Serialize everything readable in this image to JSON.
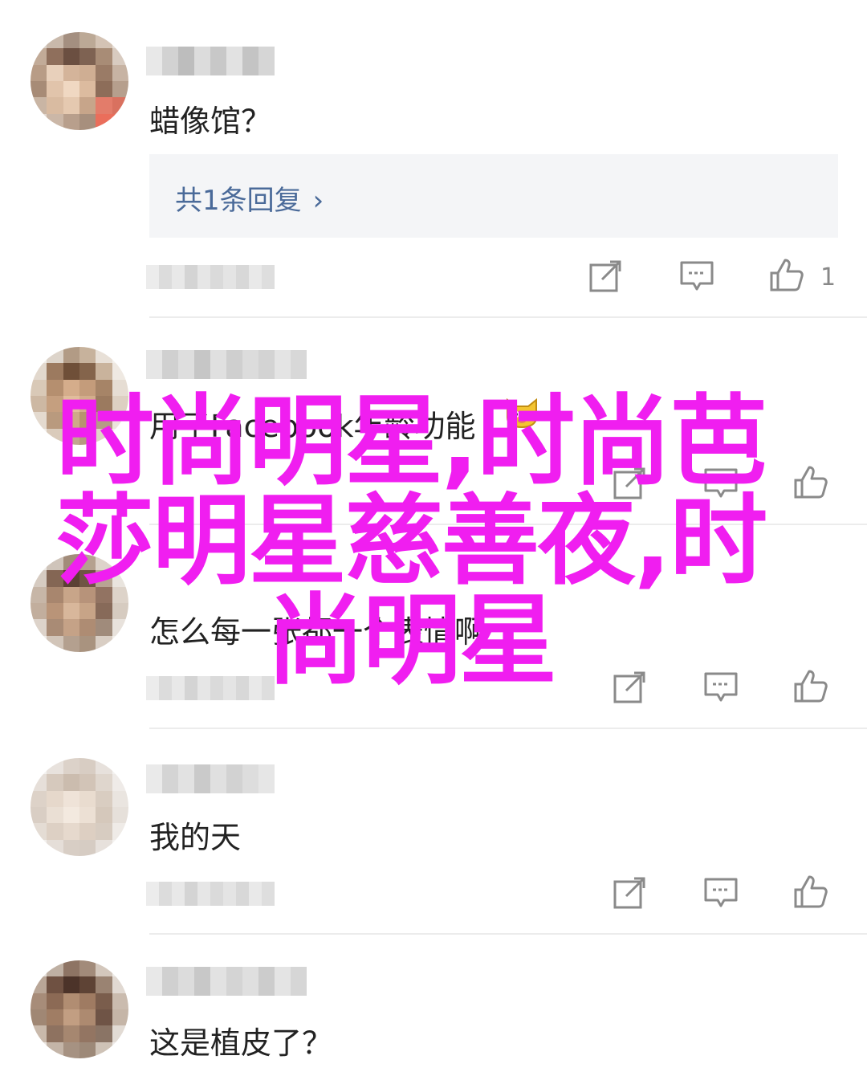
{
  "comments": [
    {
      "text": "蜡像馆？",
      "reply_link": "共1条回复",
      "like_count": "1"
    },
    {
      "text": "用了Facebook年龄功能"
    },
    {
      "text": "怎么每一张都一个表情啊"
    },
    {
      "text": "我的天"
    },
    {
      "text": "这是植皮了？"
    }
  ],
  "icons": {
    "share": "share-icon",
    "comment": "comment-icon",
    "like": "thumbs-up-icon",
    "reply_chevron": "chevron-right-icon",
    "emoji": "cat-emoji-icon"
  },
  "reply_chevron_glyph": "›",
  "overlay": {
    "title": "时尚明星,时尚芭莎明星慈善夜,时尚明星",
    "color": "#f01ef0"
  }
}
